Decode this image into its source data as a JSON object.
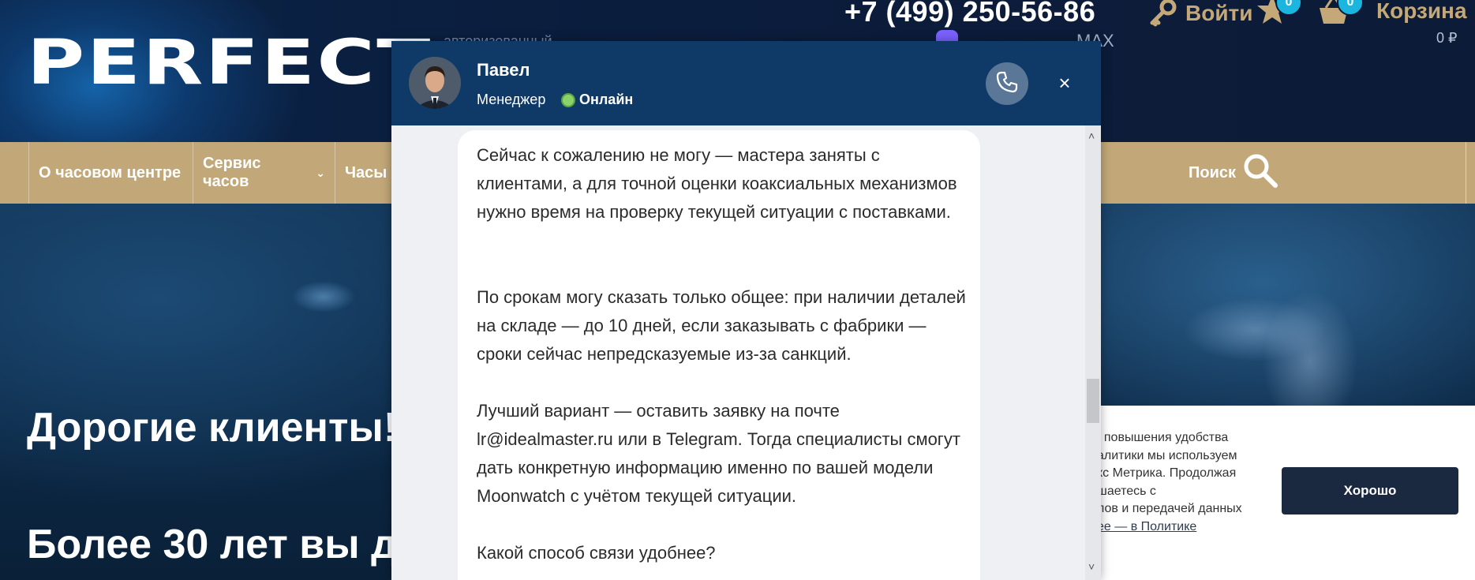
{
  "header": {
    "logo": "PERFECT",
    "auth_hint": "авторизованный",
    "phone": "+7 (499) 250-56-86",
    "messenger_label": "MAX",
    "login_label": "Войти",
    "favorites_count": "0",
    "cart_count": "0",
    "cart_label": "Корзина",
    "cart_sum": "0 ₽"
  },
  "nav": {
    "items": [
      {
        "label": "О часовом центре"
      },
      {
        "label": "Сервис часов"
      },
      {
        "label": "Часы"
      }
    ],
    "search_label": "Поиск"
  },
  "hero": {
    "title": "Дорогие клиенты!",
    "subtitle": "Более 30 лет вы д"
  },
  "chat": {
    "agent_name": "Павел",
    "agent_role": "Менеджер",
    "status": "Онлайн",
    "message_paragraphs": [
      "Сейчас к сожалению не могу — мастера заняты с клиентами, а для точной оценки коаксиальных механизмов нужно время на проверку текущей ситуации с поставками.",
      "По срокам могу сказать только общее: при наличии деталей на складе — до 10 дней, если заказывать с фабрики — сроки сейчас непредсказуемые из-за санкций.",
      "Лучший вариант — оставить заявку на почте lr@idealmaster.ru или в Telegram. Тогда специалисты смогут дать конкретную информацию именно по вашей модели Moonwatch с учётом текущей ситуации.",
      "Какой способ связи удобнее?"
    ]
  },
  "cookie": {
    "text": ", повышения удобства\nалитики мы используем\nкс Метрика. Продолжая\nшаетесь с\nлов и передачей данных",
    "link": "ее — в Политике",
    "button": "Хорошо"
  },
  "colors": {
    "nav_bg": "#c2a878",
    "chat_header": "#0f3a68",
    "accent_gold": "#c4a878",
    "badge": "#1bb6e0",
    "online": "#8cd26a"
  },
  "icons": [
    "key-icon",
    "star-icon",
    "basket-icon",
    "viber-icon",
    "search-icon",
    "phone-icon",
    "close-icon",
    "chevron-down-icon"
  ]
}
